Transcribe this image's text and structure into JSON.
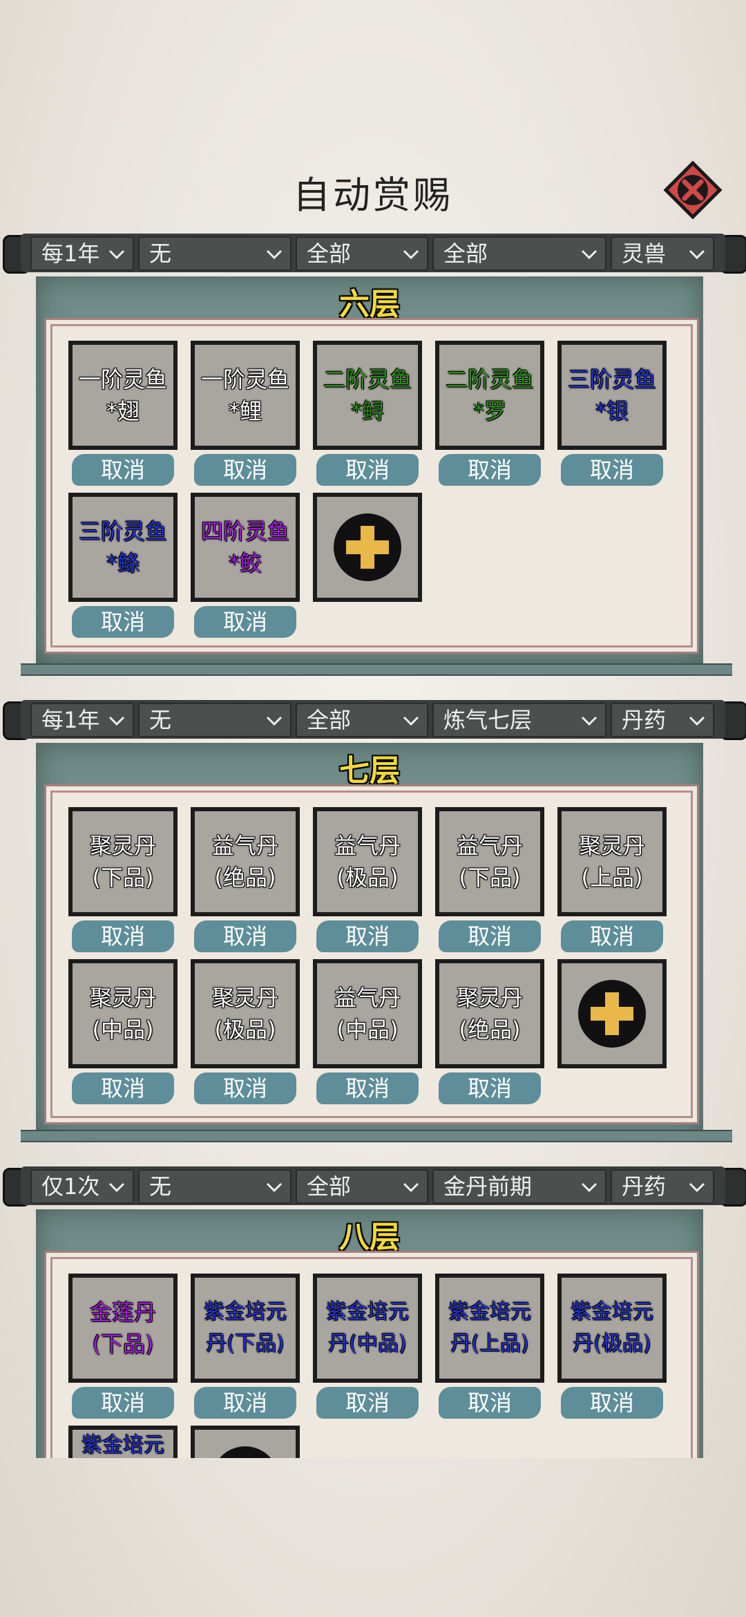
{
  "title": "自动赏赐",
  "sections": [
    {
      "filters": [
        "每1年",
        "无",
        "全部",
        "全部",
        "灵兽"
      ],
      "layer": "六层",
      "items": [
        {
          "line1": "一阶灵鱼",
          "line2": "*翅",
          "color": "white"
        },
        {
          "line1": "一阶灵鱼",
          "line2": "*鲤",
          "color": "white"
        },
        {
          "line1": "二阶灵鱼",
          "line2": "*鲟",
          "color": "green"
        },
        {
          "line1": "二阶灵鱼",
          "line2": "*罗",
          "color": "green"
        },
        {
          "line1": "三阶灵鱼",
          "line2": "*银",
          "color": "blue"
        },
        {
          "line1": "三阶灵鱼",
          "line2": "*鲦",
          "color": "blue"
        },
        {
          "line1": "四阶灵鱼",
          "line2": "*鲛",
          "color": "purple"
        }
      ],
      "cancel_label": "取消"
    },
    {
      "filters": [
        "每1年",
        "无",
        "全部",
        "炼气七层",
        "丹药"
      ],
      "layer": "七层",
      "items": [
        {
          "line1": "聚灵丹",
          "line2": "(下品)",
          "color": "white"
        },
        {
          "line1": "益气丹",
          "line2": "(绝品)",
          "color": "white"
        },
        {
          "line1": "益气丹",
          "line2": "(极品)",
          "color": "white"
        },
        {
          "line1": "益气丹",
          "line2": "(下品)",
          "color": "white"
        },
        {
          "line1": "聚灵丹",
          "line2": "(上品)",
          "color": "white"
        },
        {
          "line1": "聚灵丹",
          "line2": "(中品)",
          "color": "white"
        },
        {
          "line1": "聚灵丹",
          "line2": "(极品)",
          "color": "white"
        },
        {
          "line1": "益气丹",
          "line2": "(中品)",
          "color": "white"
        },
        {
          "line1": "聚灵丹",
          "line2": "(绝品)",
          "color": "white"
        }
      ],
      "cancel_label": "取消"
    },
    {
      "filters": [
        "仅1次",
        "无",
        "全部",
        "金丹前期",
        "丹药"
      ],
      "layer": "八层",
      "items": [
        {
          "line1": "金莲丹",
          "line2": "(下品)",
          "color": "purple"
        },
        {
          "line1": "紫金培元",
          "line2": "丹(下品)",
          "color": "blue"
        },
        {
          "line1": "紫金培元",
          "line2": "丹(中品)",
          "color": "blue"
        },
        {
          "line1": "紫金培元",
          "line2": "丹(上品)",
          "color": "blue"
        },
        {
          "line1": "紫金培元",
          "line2": "丹(极品)",
          "color": "blue"
        },
        {
          "line1": "紫金培元",
          "line2": "",
          "color": "blue"
        }
      ],
      "cancel_label": "取消"
    }
  ],
  "icons": {
    "close": "close-x-icon",
    "add": "plus-icon",
    "dropdown": "chevron-down-icon"
  },
  "colors": {
    "panel": "#6f8c88",
    "cancel": "#5e8e99",
    "layer_title": "#f2d93a",
    "close_bg": "#d04848"
  }
}
